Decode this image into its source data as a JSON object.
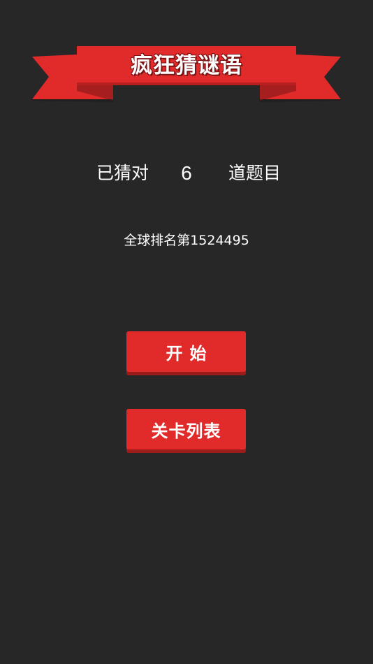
{
  "title": "疯狂猜谜语",
  "score": {
    "prefix": "已猜对",
    "count": "6",
    "suffix": "道题目"
  },
  "ranking": "全球排名第1524495",
  "buttons": {
    "start": "开始",
    "levels": "关卡列表"
  },
  "colors": {
    "background": "#272727",
    "accent_red": "#e12a2a",
    "ribbon_shadow": "#9c1b1b",
    "text": "#ffffff"
  }
}
